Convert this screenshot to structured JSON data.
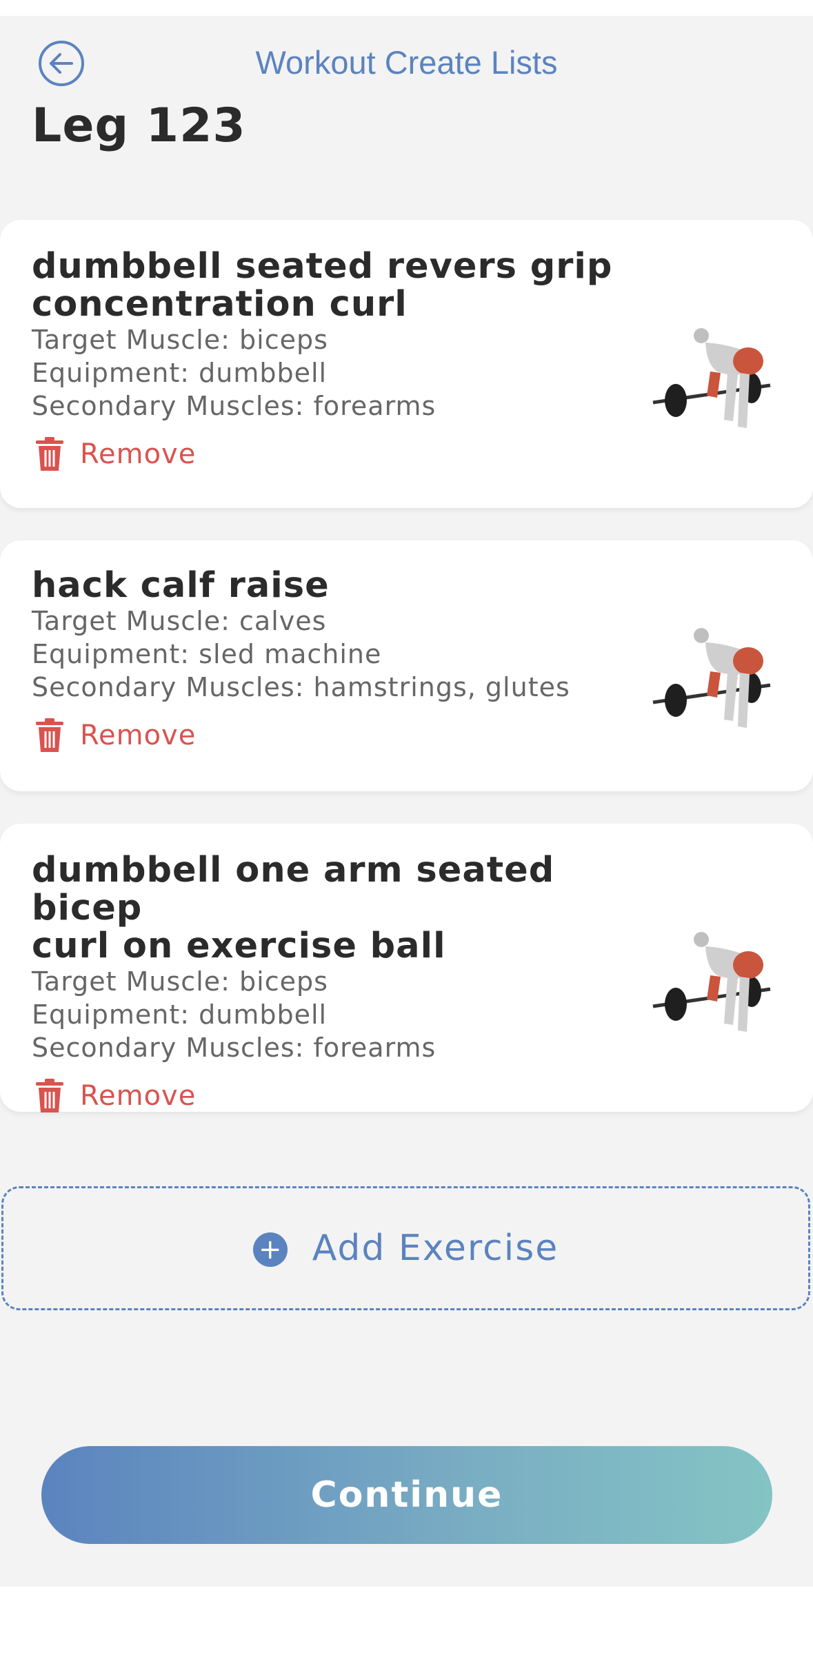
{
  "header": {
    "nav_title": "Workout Create Lists",
    "page_title": "Leg 123"
  },
  "exercises": [
    {
      "name_line1": "dumbbell seated revers grip",
      "name_line2": "concentration curl",
      "target": "Target Muscle: biceps",
      "equipment": "Equipment: dumbbell",
      "secondary": "Secondary Muscles: forearms",
      "remove_label": "Remove"
    },
    {
      "name_line1": "hack calf raise",
      "name_line2": "",
      "target": "Target Muscle: calves",
      "equipment": "Equipment: sled machine",
      "secondary": "Secondary Muscles: hamstrings, glutes",
      "remove_label": "Remove"
    },
    {
      "name_line1": "dumbbell one arm seated bicep",
      "name_line2": "curl on exercise ball",
      "target": "Target Muscle: biceps",
      "equipment": "Equipment: dumbbell",
      "secondary": "Secondary Muscles: forearms",
      "remove_label": "Remove"
    }
  ],
  "actions": {
    "add_exercise": "Add Exercise",
    "add_icon": "+",
    "continue": "Continue"
  },
  "icons": {
    "back": "arrow-left-circle-icon",
    "remove": "trash-icon",
    "add": "plus-circle-icon"
  },
  "colors": {
    "accent": "#5b83bf",
    "danger": "#d9534f",
    "gradient_start": "#5b84bf",
    "gradient_end": "#84c4c4"
  }
}
